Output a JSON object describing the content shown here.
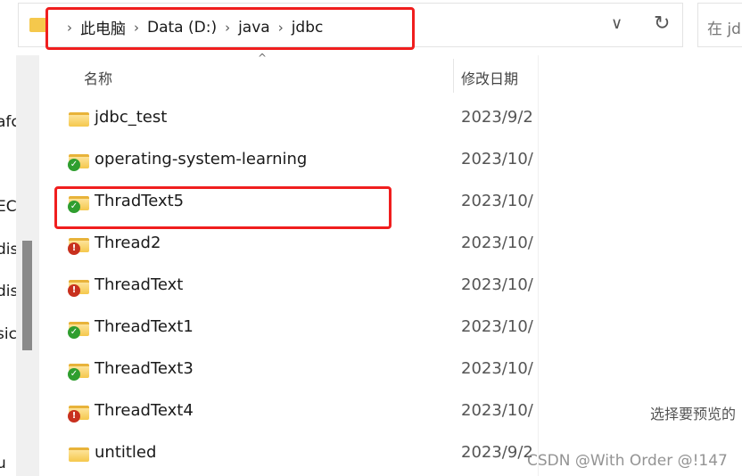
{
  "address": {
    "crumbs": [
      "此电脑",
      "Data (D:)",
      "java",
      "jdbc"
    ]
  },
  "search": {
    "placeholder": "在 jdbc"
  },
  "nav": {
    "fragments": [
      "afc",
      "EC",
      "dis",
      "dis",
      "sic",
      "u"
    ]
  },
  "columns": {
    "name": "名称",
    "date": "修改日期"
  },
  "files": [
    {
      "name": "jdbc_test",
      "date": "2023/9/2",
      "status": "none"
    },
    {
      "name": "operating-system-learning",
      "date": "2023/10/",
      "status": "ok"
    },
    {
      "name": "ThradText5",
      "date": "2023/10/",
      "status": "ok"
    },
    {
      "name": "Thread2",
      "date": "2023/10/",
      "status": "error"
    },
    {
      "name": "ThreadText",
      "date": "2023/10/",
      "status": "error"
    },
    {
      "name": "ThreadText1",
      "date": "2023/10/",
      "status": "ok"
    },
    {
      "name": "ThreadText3",
      "date": "2023/10/",
      "status": "ok"
    },
    {
      "name": "ThreadText4",
      "date": "2023/10/",
      "status": "error"
    },
    {
      "name": "untitled",
      "date": "2023/9/2",
      "status": "none"
    }
  ],
  "preview": {
    "text": "选择要预览的"
  },
  "watermark": "CSDN @With Order @!147",
  "colors": {
    "highlight": "#f01e1e",
    "folder": "#f5c84c",
    "ok": "#2f9e2f",
    "error": "#c8301e"
  }
}
